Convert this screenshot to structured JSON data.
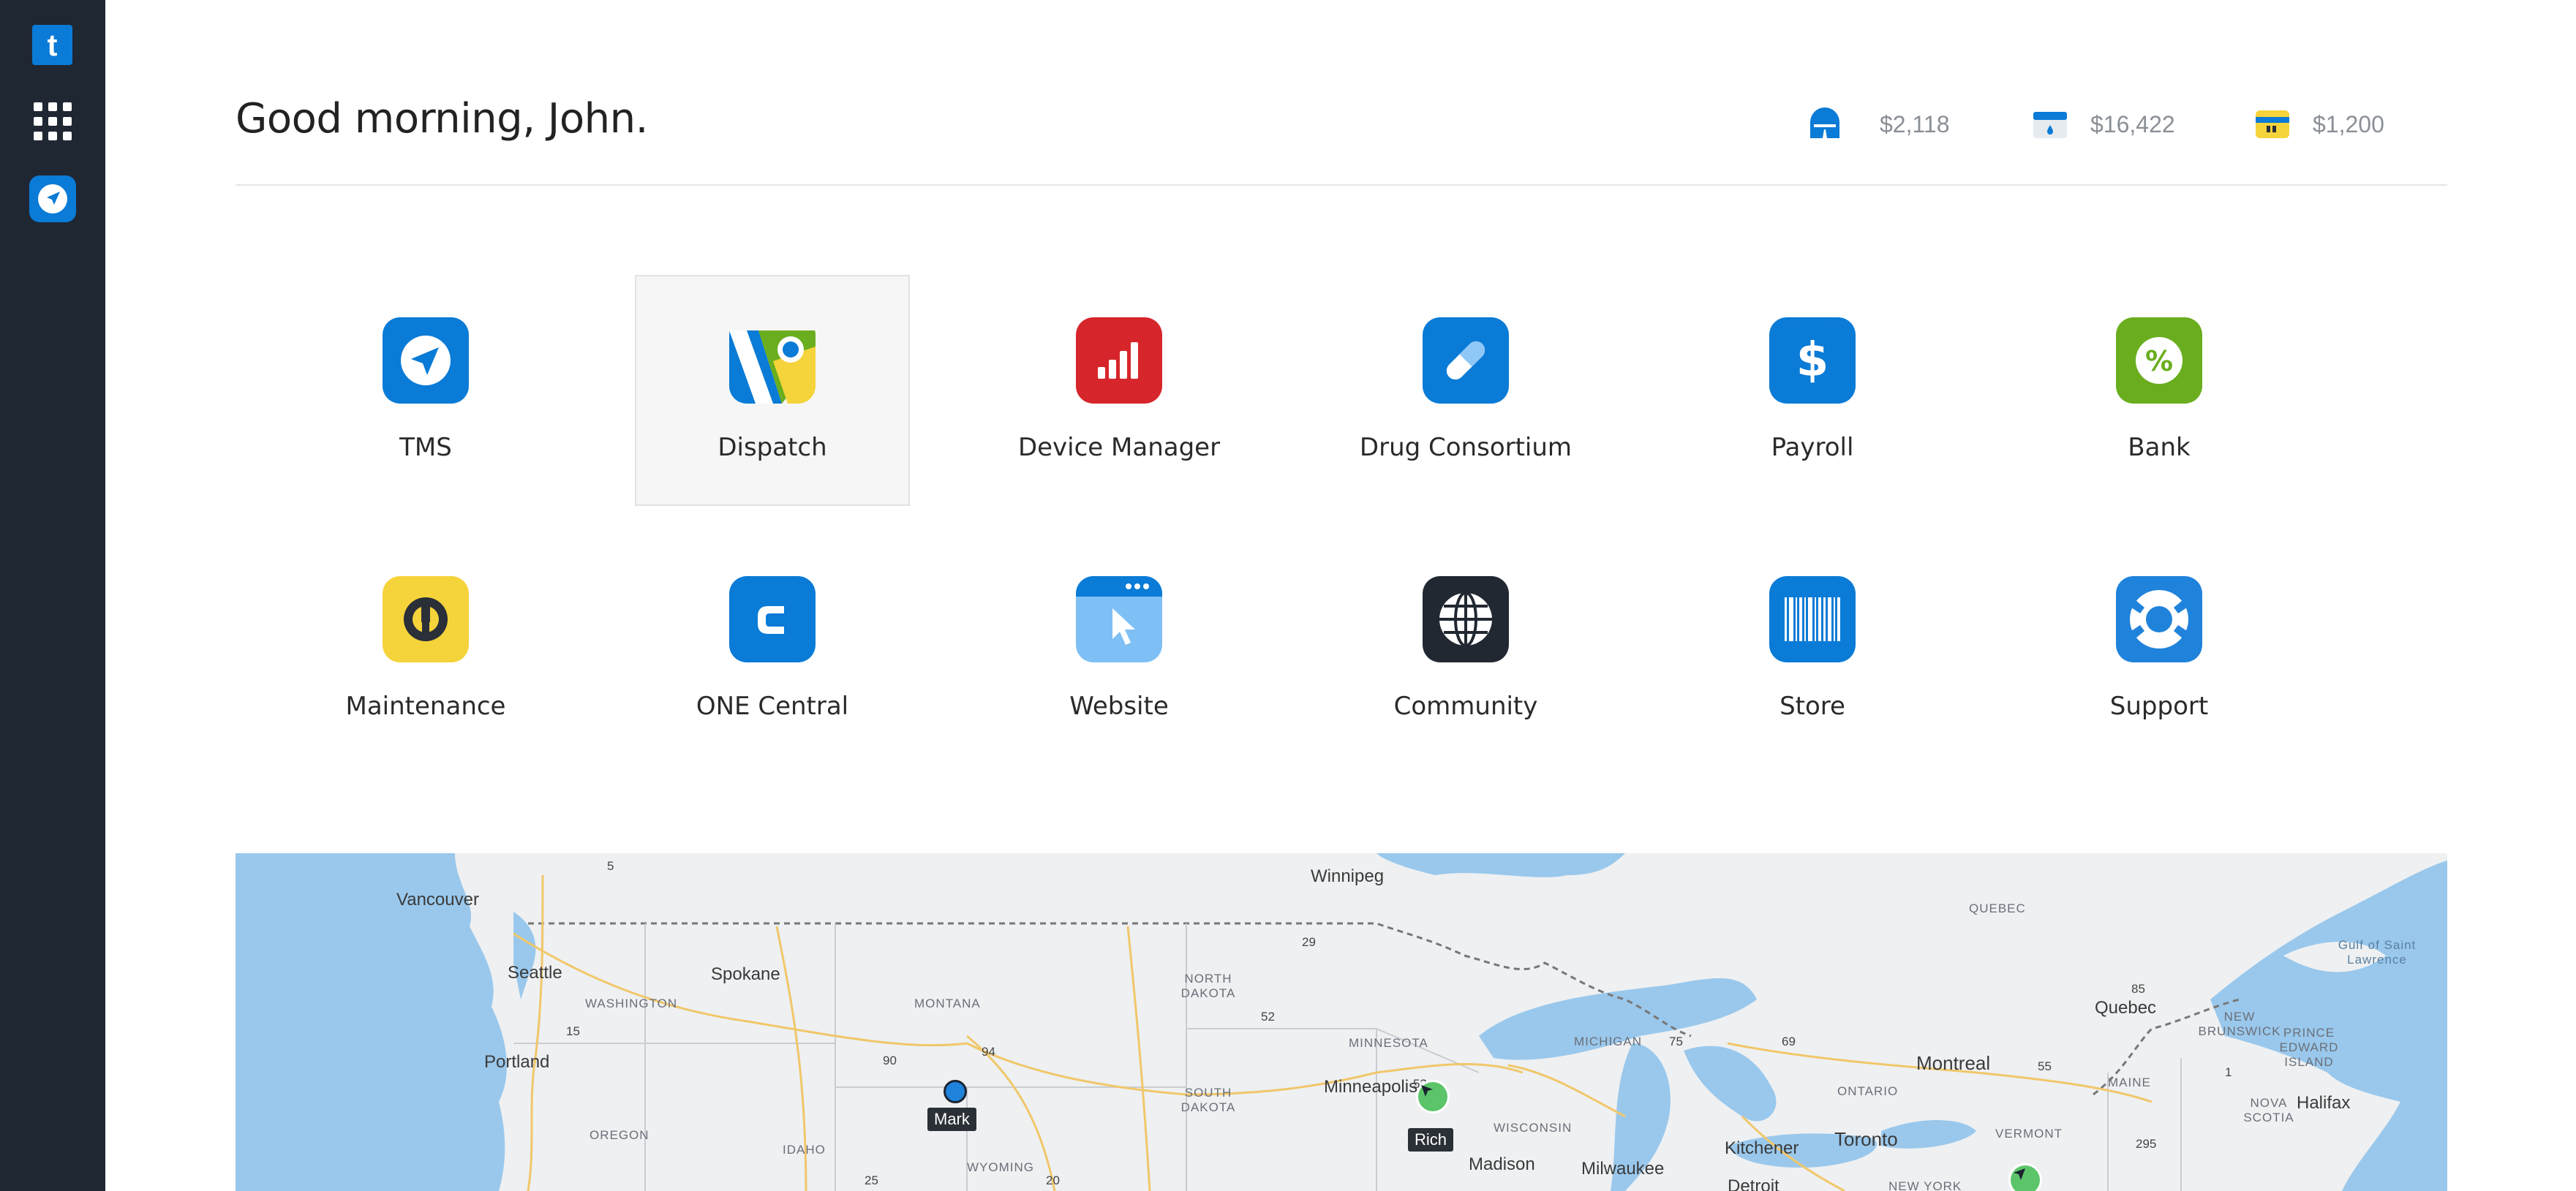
{
  "greeting": "Good morning, John.",
  "balances": [
    {
      "icon": "fuel-card-icon",
      "value": "$2,118"
    },
    {
      "icon": "fuel-pump-card-icon",
      "value": "$16,422"
    },
    {
      "icon": "wallet-card-icon",
      "value": "$1,200"
    }
  ],
  "apps": [
    {
      "label": "TMS",
      "icon": "tms-navigation-icon",
      "color": "#0a7bd6"
    },
    {
      "label": "Dispatch",
      "icon": "dispatch-map-icon",
      "color": "#ffffff"
    },
    {
      "label": "Device Manager",
      "icon": "signal-bars-icon",
      "color": "#d6262b"
    },
    {
      "label": "Drug Consortium",
      "icon": "pill-icon",
      "color": "#0a7bd6"
    },
    {
      "label": "Payroll",
      "icon": "dollar-icon",
      "color": "#0a7bd6"
    },
    {
      "label": "Bank",
      "icon": "percent-icon",
      "color": "#6aae1f"
    },
    {
      "label": "Maintenance",
      "icon": "wrench-icon",
      "color": "#f5d33a"
    },
    {
      "label": "ONE Central",
      "icon": "one-central-c-icon",
      "color": "#0a7bd6"
    },
    {
      "label": "Website",
      "icon": "browser-cursor-icon",
      "color": "#7ec0f5"
    },
    {
      "label": "Community",
      "icon": "globe-icon",
      "color": "#222831"
    },
    {
      "label": "Store",
      "icon": "barcode-icon",
      "color": "#0a7bd6"
    },
    {
      "label": "Support",
      "icon": "lifebuoy-icon",
      "color": "#1f83dc"
    }
  ],
  "map": {
    "cities": [
      "Vancouver",
      "Seattle",
      "Portland",
      "Spokane",
      "Winnipeg",
      "Minneapolis",
      "Madison",
      "Milwaukee",
      "Toronto",
      "Kitchener",
      "Montreal",
      "Quebec",
      "Halifax",
      "Detroit"
    ],
    "states": [
      "WASHINGTON",
      "OREGON",
      "IDAHO",
      "MONTANA",
      "WYOMING",
      "NORTH DAKOTA",
      "SOUTH DAKOTA",
      "MINNESOTA",
      "WISCONSIN",
      "MICHIGAN",
      "ONTARIO",
      "QUEBEC",
      "NEW BRUNSWICK",
      "PRINCE EDWARD ISLAND",
      "NOVA SCOTIA",
      "MAINE",
      "VERMONT",
      "NEW YORK",
      "Gulf of Saint Lawrence"
    ],
    "routes": [
      "5",
      "15",
      "90",
      "94",
      "29",
      "52",
      "53",
      "69",
      "75",
      "55",
      "85",
      "1",
      "295",
      "25",
      "20"
    ],
    "markers": [
      {
        "name": "Mark",
        "kind": "driver-dot"
      },
      {
        "name": "Rich",
        "kind": "navigation-arrow"
      }
    ]
  }
}
